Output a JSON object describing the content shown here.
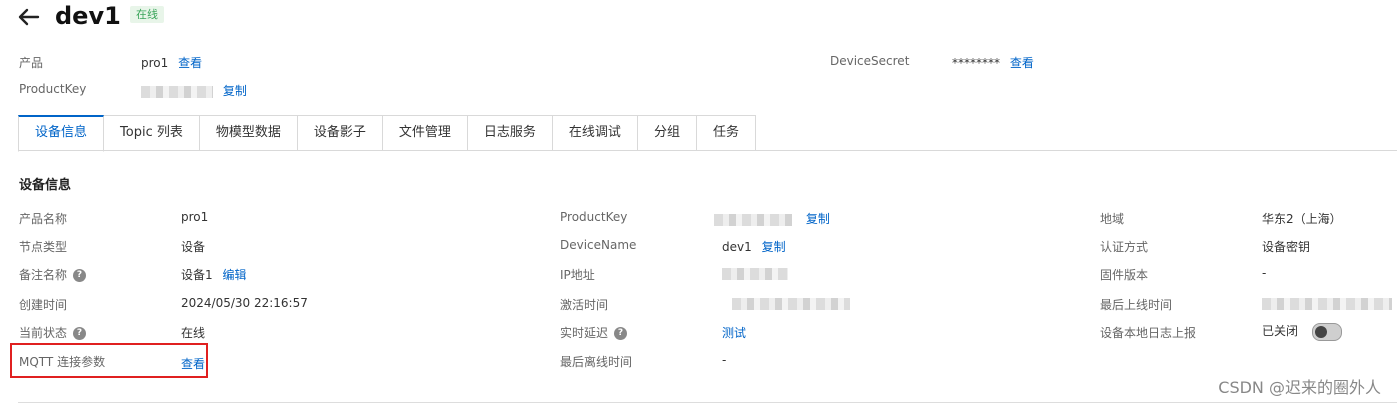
{
  "header": {
    "title": "dev1",
    "status": "在线"
  },
  "summary": {
    "product_label": "产品",
    "product_value": "pro1",
    "product_link": "查看",
    "productkey_label": "ProductKey",
    "productkey_copy": "复制",
    "devicesecret_label": "DeviceSecret",
    "devicesecret_value": "********",
    "devicesecret_link": "查看"
  },
  "tabs": [
    {
      "label": "设备信息",
      "active": true
    },
    {
      "label": "Topic 列表"
    },
    {
      "label": "物模型数据"
    },
    {
      "label": "设备影子"
    },
    {
      "label": "文件管理"
    },
    {
      "label": "日志服务"
    },
    {
      "label": "在线调试"
    },
    {
      "label": "分组"
    },
    {
      "label": "任务"
    }
  ],
  "info": {
    "section_title": "设备信息",
    "col1": {
      "product_name_label": "产品名称",
      "product_name": "pro1",
      "node_type_label": "节点类型",
      "node_type": "设备",
      "remark_label": "备注名称",
      "remark": "设备1",
      "remark_edit": "编辑",
      "created_label": "创建时间",
      "created": "2024/05/30 22:16:57",
      "state_label": "当前状态",
      "state": "在线",
      "mqtt_label": "MQTT 连接参数",
      "mqtt_link": "查看"
    },
    "col2": {
      "productkey_label": "ProductKey",
      "productkey_copy": "复制",
      "devicename_label": "DeviceName",
      "devicename": "dev1",
      "devicename_copy": "复制",
      "ip_label": "IP地址",
      "activated_label": "激活时间",
      "latency_label": "实时延迟",
      "latency_link": "测试",
      "last_offline_label": "最后离线时间",
      "last_offline": "-"
    },
    "col3": {
      "region_label": "地域",
      "region": "华东2（上海）",
      "auth_label": "认证方式",
      "auth": "设备密钥",
      "firmware_label": "固件版本",
      "firmware": "-",
      "last_online_label": "最后上线时间",
      "local_log_label": "设备本地日志上报",
      "local_log": "已关闭"
    }
  },
  "watermark": "CSDN @迟来的圈外人"
}
